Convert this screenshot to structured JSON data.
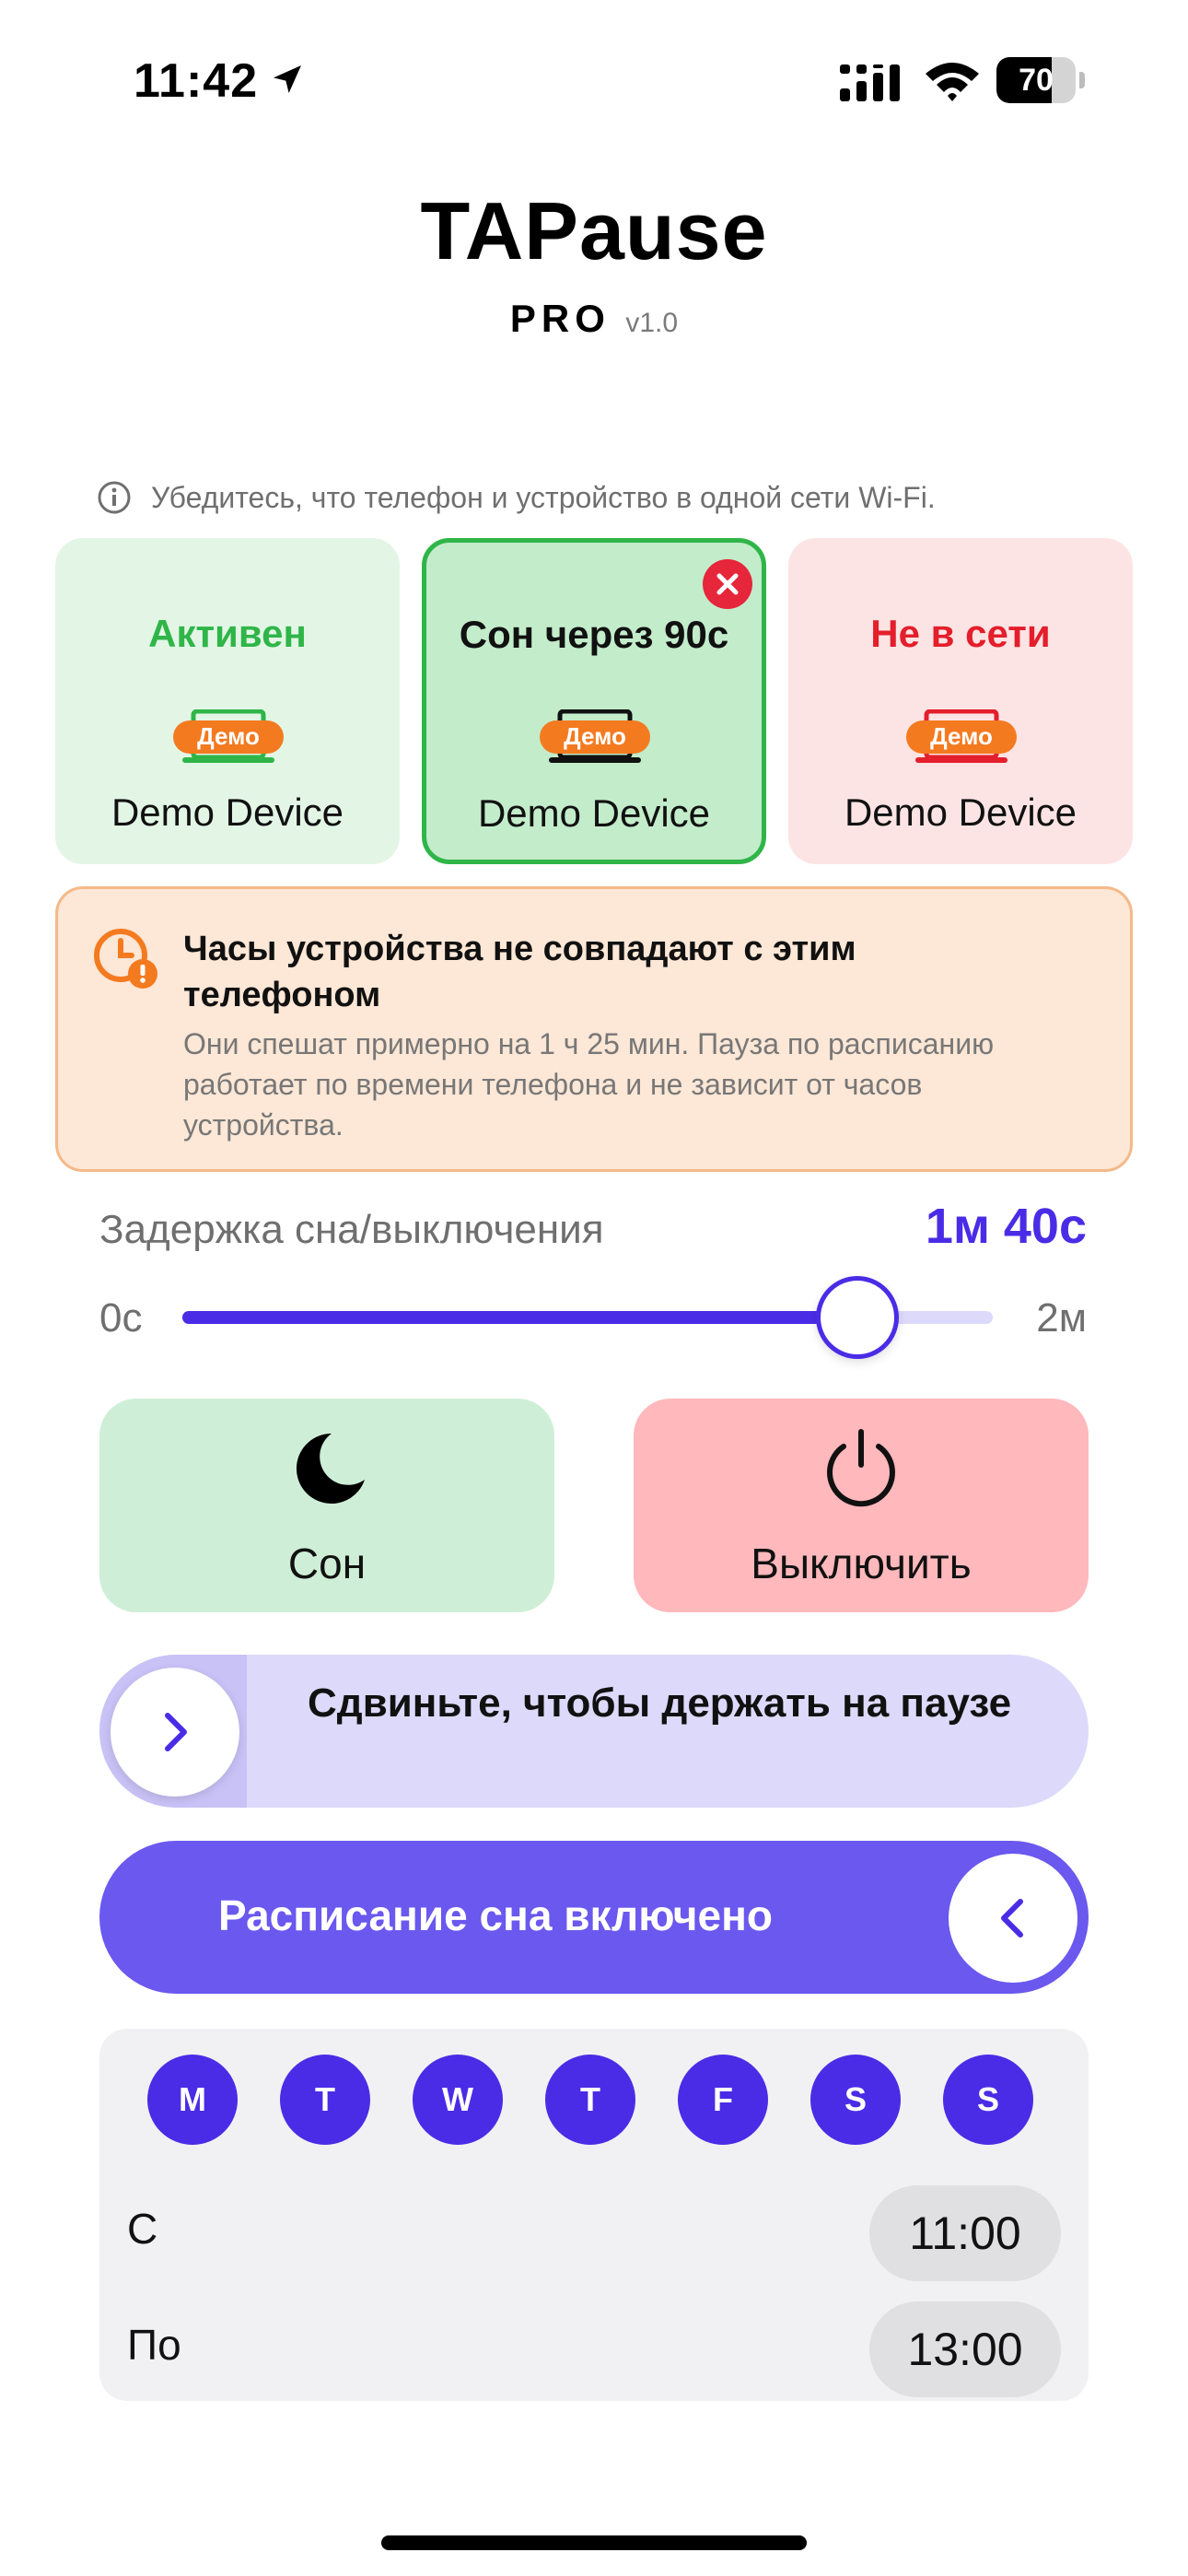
{
  "status_bar": {
    "time": "11:42",
    "battery": "70",
    "battery_level": 0.7
  },
  "header": {
    "title": "TAPause",
    "edition": "PRO",
    "version": "v1.0"
  },
  "wifi_note": "Убедитесь, что телефон и устройство в одной сети Wi-Fi.",
  "devices": [
    {
      "status": "Активен",
      "badge": "Демо",
      "name": "Demo Device",
      "state_color": "#2fb548"
    },
    {
      "status": "Сон через 90с",
      "badge": "Демо",
      "name": "Demo Device",
      "state_color": "#111111",
      "selected": true
    },
    {
      "status": "Не в сети",
      "badge": "Демо",
      "name": "Demo Device",
      "state_color": "#e41e2b"
    }
  ],
  "warning": {
    "title": "Часы устройства не совпадают с этим телефоном",
    "body": "Они спешат примерно на 1 ч 25 мин. Пауза по расписанию работает по времени телефона и не зависит от часов устройства."
  },
  "delay": {
    "label": "Задержка сна/выключения",
    "value": "1м 40с",
    "min": "0с",
    "max": "2м",
    "fraction": 0.8333
  },
  "actions": {
    "sleep": "Сон",
    "power_off": "Выключить"
  },
  "swipe": {
    "text": "Сдвиньте, чтобы держать на паузе"
  },
  "schedule": {
    "toggle_label": "Расписание сна включено",
    "enabled": true,
    "days": [
      "M",
      "T",
      "W",
      "T",
      "F",
      "S",
      "S"
    ],
    "from_label": "С",
    "from_time": "11:00",
    "to_label": "По",
    "to_time": "13:00"
  },
  "colors": {
    "accent": "#4a2ce6",
    "toggle_bg": "#6a58ef",
    "badge": "#f47a20"
  }
}
